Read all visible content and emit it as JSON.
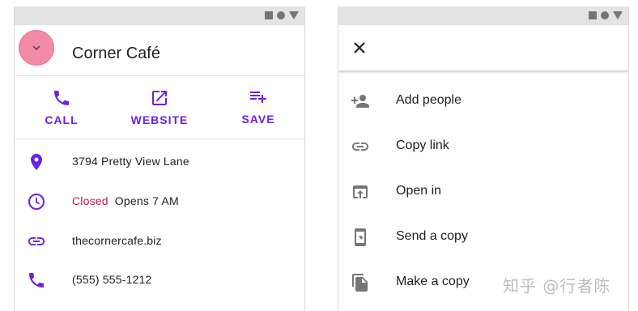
{
  "left_screen": {
    "title": "Corner Café",
    "actions": [
      {
        "label": "CALL",
        "icon": "phone-icon"
      },
      {
        "label": "WEBSITE",
        "icon": "open-in-new-icon"
      },
      {
        "label": "SAVE",
        "icon": "playlist-add-icon"
      }
    ],
    "address": "3794 Pretty View Lane",
    "hours_status": "Closed",
    "hours_detail": "Opens 7 AM",
    "website": "thecornercafe.biz",
    "phone": "(555) 555-1212"
  },
  "right_screen": {
    "menu_items": [
      {
        "label": "Add people",
        "icon": "person-add-icon"
      },
      {
        "label": "Copy link",
        "icon": "link-icon"
      },
      {
        "label": "Open in",
        "icon": "open-in-browser-icon"
      },
      {
        "label": "Send a copy",
        "icon": "send-to-mobile-icon"
      },
      {
        "label": "Make a copy",
        "icon": "file-copy-icon"
      }
    ]
  },
  "watermark": "知乎 @行者陈",
  "colors": {
    "accent": "#6b21e0",
    "closed": "#c2185b",
    "ripple": "#f28ca6",
    "icon_grey": "#757575"
  }
}
